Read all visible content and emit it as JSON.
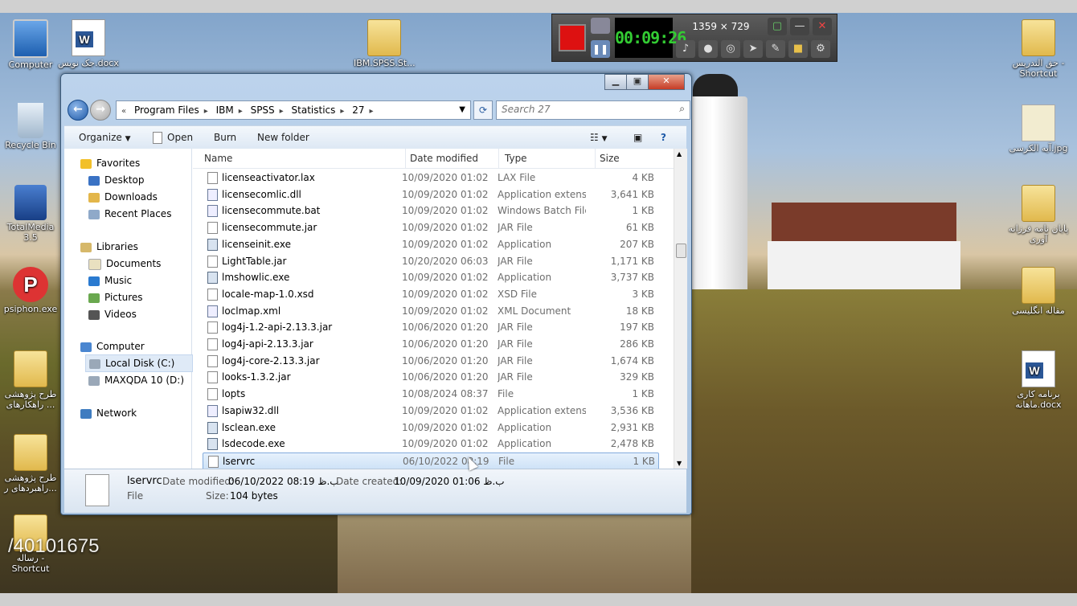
{
  "desktop": {
    "icons": [
      {
        "label": "Computer",
        "icon": "computer-icon"
      },
      {
        "label": "جک نویس.docx",
        "icon": "word-document-icon"
      },
      {
        "label": "IBM.SPSS.St...",
        "icon": "folder-icon"
      },
      {
        "label": "Recycle Bin",
        "icon": "recycle-bin-icon"
      },
      {
        "label": "TotalMedia 3.5",
        "icon": "totalmedia-icon"
      },
      {
        "label": "psiphon.exe",
        "icon": "psiphon-icon"
      },
      {
        "label": "طرح پژوهشی راهکارهای ...",
        "icon": "folder-icon"
      },
      {
        "label": "طرح پژوهشی راهبردهای ر...",
        "icon": "folder-icon"
      },
      {
        "label": "رساله - Shortcut",
        "icon": "folder-icon"
      },
      {
        "label": "حق التدریس - Shortcut",
        "icon": "folder-icon"
      },
      {
        "label": "آیه الکرسی.jpg",
        "icon": "image-icon"
      },
      {
        "label": "پایان نامه فرزانه آوری",
        "icon": "folder-icon"
      },
      {
        "label": "مقاله انگلیسی",
        "icon": "folder-icon"
      },
      {
        "label": "برنامه کاری ماهانه.docx",
        "icon": "word-document-icon"
      }
    ],
    "watermark": "/40101675"
  },
  "recorder": {
    "timer": "00:09:26",
    "dimensions": "1359 × 729"
  },
  "explorer": {
    "breadcrumb": [
      "Program Files",
      "IBM",
      "SPSS",
      "Statistics",
      "27"
    ],
    "search_placeholder": "Search 27",
    "toolbar": {
      "organize": "Organize",
      "open": "Open",
      "burn": "Burn",
      "new_folder": "New folder"
    },
    "nav": {
      "favorites": "Favorites",
      "desktop": "Desktop",
      "downloads": "Downloads",
      "recent": "Recent Places",
      "libraries": "Libraries",
      "documents": "Documents",
      "music": "Music",
      "pictures": "Pictures",
      "videos": "Videos",
      "computer": "Computer",
      "local_disk": "Local Disk (C:)",
      "maxqda": "MAXQDA 10 (D:)",
      "network": "Network"
    },
    "columns": {
      "name": "Name",
      "date": "Date modified",
      "type": "Type",
      "size": "Size"
    },
    "files": [
      {
        "name": "licenseactivator.lax",
        "date": "10/09/2020 01:02 ...",
        "type": "LAX File",
        "size": "4 KB",
        "kind": "file"
      },
      {
        "name": "licensecomlic.dll",
        "date": "10/09/2020 01:02 ...",
        "type": "Application extens...",
        "size": "3,641 KB",
        "kind": "dll"
      },
      {
        "name": "licensecommute.bat",
        "date": "10/09/2020 01:02 ...",
        "type": "Windows Batch File",
        "size": "1 KB",
        "kind": "dll"
      },
      {
        "name": "licensecommute.jar",
        "date": "10/09/2020 01:02 ...",
        "type": "JAR File",
        "size": "61 KB",
        "kind": "file"
      },
      {
        "name": "licenseinit.exe",
        "date": "10/09/2020 01:02 ...",
        "type": "Application",
        "size": "207 KB",
        "kind": "exe"
      },
      {
        "name": "LightTable.jar",
        "date": "10/20/2020 06:03 ...",
        "type": "JAR File",
        "size": "1,171 KB",
        "kind": "file"
      },
      {
        "name": "lmshowlic.exe",
        "date": "10/09/2020 01:02 ...",
        "type": "Application",
        "size": "3,737 KB",
        "kind": "exe"
      },
      {
        "name": "locale-map-1.0.xsd",
        "date": "10/09/2020 01:02 ...",
        "type": "XSD File",
        "size": "3 KB",
        "kind": "file"
      },
      {
        "name": "loclmap.xml",
        "date": "10/09/2020 01:02 ...",
        "type": "XML Document",
        "size": "18 KB",
        "kind": "dll"
      },
      {
        "name": "log4j-1.2-api-2.13.3.jar",
        "date": "10/06/2020 01:20 ...",
        "type": "JAR File",
        "size": "197 KB",
        "kind": "file"
      },
      {
        "name": "log4j-api-2.13.3.jar",
        "date": "10/06/2020 01:20 ...",
        "type": "JAR File",
        "size": "286 KB",
        "kind": "file"
      },
      {
        "name": "log4j-core-2.13.3.jar",
        "date": "10/06/2020 01:20 ...",
        "type": "JAR File",
        "size": "1,674 KB",
        "kind": "file"
      },
      {
        "name": "looks-1.3.2.jar",
        "date": "10/06/2020 01:20 ...",
        "type": "JAR File",
        "size": "329 KB",
        "kind": "file"
      },
      {
        "name": "lopts",
        "date": "10/08/2024 08:37 ...",
        "type": "File",
        "size": "1 KB",
        "kind": "file"
      },
      {
        "name": "lsapiw32.dll",
        "date": "10/09/2020 01:02 ...",
        "type": "Application extens...",
        "size": "3,536 KB",
        "kind": "dll"
      },
      {
        "name": "lsclean.exe",
        "date": "10/09/2020 01:02 ...",
        "type": "Application",
        "size": "2,931 KB",
        "kind": "exe"
      },
      {
        "name": "lsdecode.exe",
        "date": "10/09/2020 01:02 ...",
        "type": "Application",
        "size": "2,478 KB",
        "kind": "exe"
      },
      {
        "name": "lservrc",
        "date": "06/10/2022 08:19 ...",
        "type": "File",
        "size": "1 KB",
        "kind": "file",
        "selected": true
      }
    ],
    "details": {
      "name": "lservrc",
      "type": "File",
      "date_modified_label": "Date modified:",
      "date_modified": "06/10/2022 08:19 ب.ظ",
      "date_created_label": "Date created:",
      "date_created": "10/09/2020 01:06 ب.ظ",
      "size_label": "Size:",
      "size": "104 bytes"
    }
  }
}
